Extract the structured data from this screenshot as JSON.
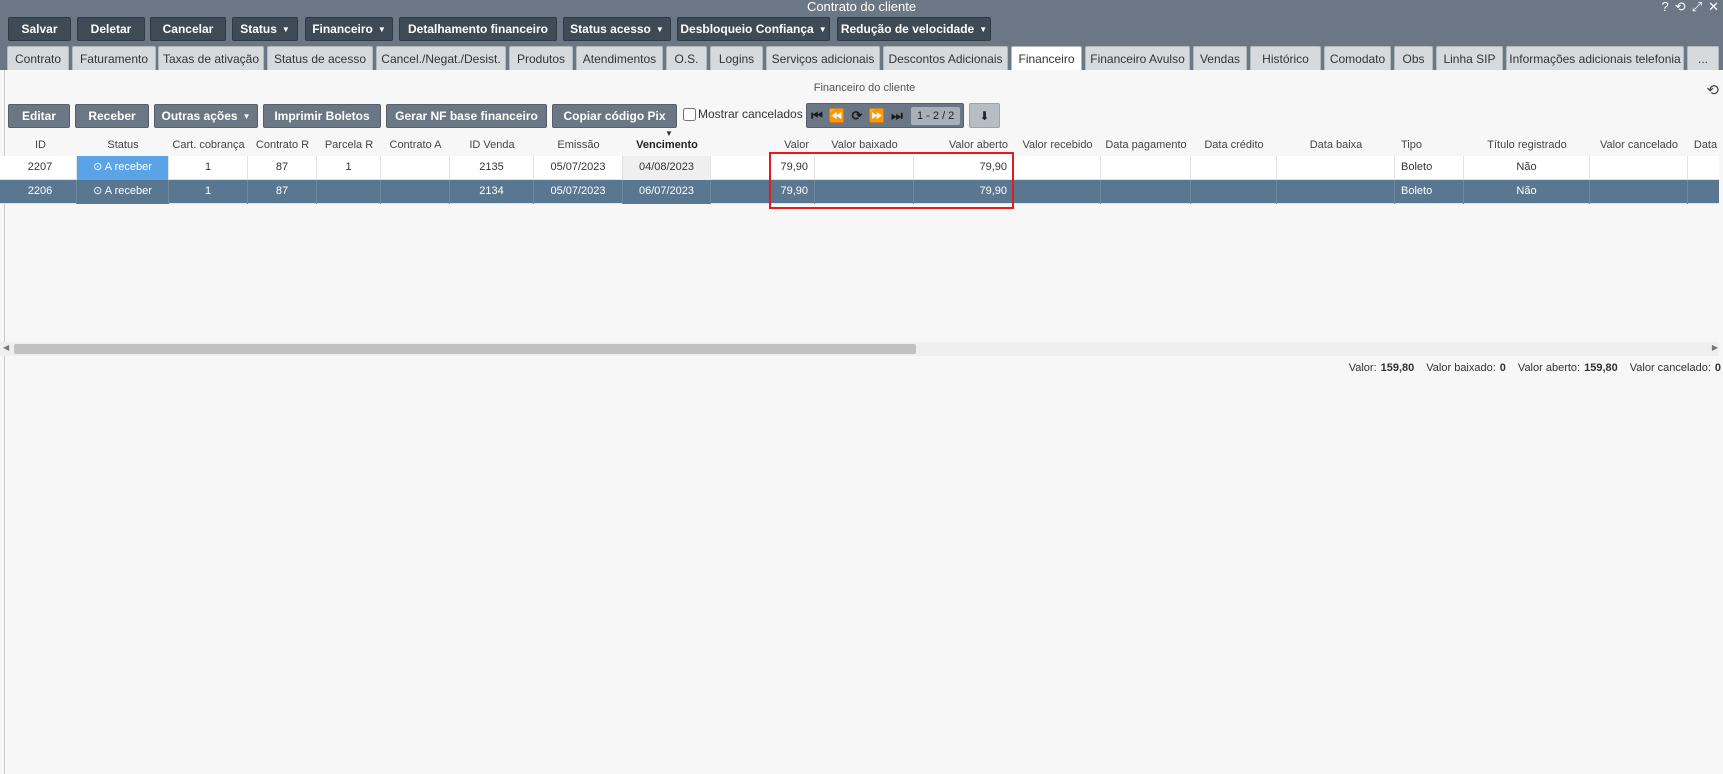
{
  "window": {
    "title": "Contrato do cliente"
  },
  "toolbar": {
    "save": "Salvar",
    "delete": "Deletar",
    "cancel": "Cancelar",
    "status": "Status",
    "financeiro": "Financeiro",
    "detalhamento": "Detalhamento financeiro",
    "status_acesso": "Status acesso",
    "desbloqueio": "Desbloqueio Confiança",
    "reducao": "Redução de velocidade"
  },
  "tabs": [
    "Contrato",
    "Faturamento",
    "Taxas de ativação",
    "Status de acesso",
    "Cancel./Negat./Desist.",
    "Produtos",
    "Atendimentos",
    "O.S.",
    "Logins",
    "Serviços adicionais",
    "Descontos Adicionais",
    "Financeiro",
    "Financeiro Avulso",
    "Vendas",
    "Histórico",
    "Comodato",
    "Obs",
    "Linha SIP",
    "Informações adicionais telefonia",
    "..."
  ],
  "grid": {
    "caption": "Financeiro do cliente",
    "buttons": {
      "editar": "Editar",
      "receber": "Receber",
      "outras": "Outras ações",
      "imprimir": "Imprimir Boletos",
      "gerar_nf": "Gerar NF base financeiro",
      "copiar_pix": "Copiar código Pix"
    },
    "show_cancelled_label": "Mostrar cancelados",
    "pager_info": "1 - 2 / 2",
    "columns": [
      "ID",
      "Status",
      "Cart. cobrança",
      "Contrato R",
      "Parcela R",
      "Contrato A",
      "ID Venda",
      "Emissão",
      "Vencimento",
      "Valor",
      "Valor baixado",
      "Valor aberto",
      "Valor recebido",
      "Data pagamento",
      "Data crédito",
      "Data baixa",
      "Tipo",
      "Título registrado",
      "Valor cancelado",
      "Data"
    ],
    "rows": [
      {
        "id": "2207",
        "status": "A receber",
        "cart": "1",
        "contrato_r": "87",
        "parcela_r": "1",
        "contrato_a": "",
        "id_venda": "2135",
        "emissao": "05/07/2023",
        "vencimento": "04/08/2023",
        "valor": "79,90",
        "valor_baixado": "",
        "valor_aberto": "79,90",
        "valor_recebido": "",
        "data_pagamento": "",
        "data_credito": "",
        "data_baixa": "",
        "tipo": "Boleto",
        "titulo": "Não",
        "valor_cancelado": ""
      },
      {
        "id": "2206",
        "status": "A receber",
        "cart": "1",
        "contrato_r": "87",
        "parcela_r": "",
        "contrato_a": "",
        "id_venda": "2134",
        "emissao": "05/07/2023",
        "vencimento": "06/07/2023",
        "valor": "79,90",
        "valor_baixado": "",
        "valor_aberto": "79,90",
        "valor_recebido": "",
        "data_pagamento": "",
        "data_credito": "",
        "data_baixa": "",
        "tipo": "Boleto",
        "titulo": "Não",
        "valor_cancelado": ""
      }
    ],
    "totals": {
      "valor_label": "Valor:",
      "valor": "159,80",
      "baixado_label": "Valor baixado:",
      "baixado": "0",
      "aberto_label": "Valor aberto:",
      "aberto": "159,80",
      "cancelado_label": "Valor cancelado:",
      "cancelado": "0"
    }
  },
  "icons": {
    "help": "?",
    "history": "⟲",
    "expand": "⤢",
    "close": "✕",
    "first": "⏮",
    "prev": "⏪",
    "refresh": "⟳",
    "next": "⏩",
    "last": "⏭",
    "download": "⬇",
    "clock": "⊙"
  }
}
